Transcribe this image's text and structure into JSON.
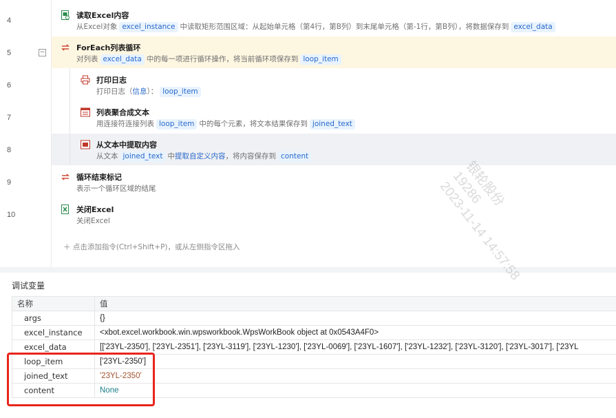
{
  "lines": [
    "4",
    "5",
    "6",
    "7",
    "8",
    "9",
    "10"
  ],
  "fold_symbol": "−",
  "commands": [
    {
      "title": "读取Excel内容",
      "desc_parts": [
        "从Excel对象",
        "excel_instance",
        "中读取矩形范围区域：从起始单元格（第4行，第B列）到末尾单元格（第-1行，第B列），将数据保存到",
        "excel_data"
      ]
    },
    {
      "title": "ForEach列表循环",
      "desc_parts": [
        "对列表",
        "excel_data",
        "中的每一项进行循环操作，将当前循环项保存到",
        "loop_item"
      ]
    },
    {
      "title": "打印日志",
      "desc_parts": [
        "打印日志（",
        "信息",
        "）：",
        "loop_item"
      ]
    },
    {
      "title": "列表聚合成文本",
      "desc_parts": [
        "用连接符连接列表",
        "loop_item",
        "中的每个元素，将文本结果保存到",
        "joined_text"
      ]
    },
    {
      "title": "从文本中提取内容",
      "desc_parts": [
        "从文本",
        "joined_text",
        "中",
        "提取自定义内容",
        "，将内容保存到",
        "content"
      ]
    },
    {
      "title": "循环结束标记",
      "desc": "表示一个循环区域的结尾"
    },
    {
      "title": "关闭Excel",
      "desc": "关闭Excel"
    }
  ],
  "add_hint": "＋  点击添加指令(Ctrl+Shift+P)，或从左侧指令区拖入",
  "debug": {
    "title": "调试变量",
    "headers": {
      "name": "名称",
      "value": "值"
    },
    "rows": [
      {
        "name": "args",
        "value": "{}"
      },
      {
        "name": "excel_instance",
        "value": "<xbot.excel.workbook.win.wpsworkbook.WpsWorkBook object at 0x0543A4F0>"
      },
      {
        "name": "excel_data",
        "value": "[['23YL-2350'], ['23YL-2351'], ['23YL-3119'], ['23YL-1230'], ['23YL-0069'], ['23YL-1607'], ['23YL-1232'], ['23YL-3120'], ['23YL-3017'], ['23YL"
      },
      {
        "name": "loop_item",
        "value": "['23YL-2350']"
      },
      {
        "name": "joined_text",
        "value": "'23YL-2350'"
      },
      {
        "name": "content",
        "value": "None"
      }
    ]
  },
  "watermark": [
    "银轮股份",
    "19286",
    "2023-11-14 14:57:58"
  ],
  "colors": {
    "highlight_row": "#fdf6e1",
    "tag_bg": "#e8f3fe",
    "tag_text": "#2868c9",
    "annotation_box": "#e8241c"
  }
}
